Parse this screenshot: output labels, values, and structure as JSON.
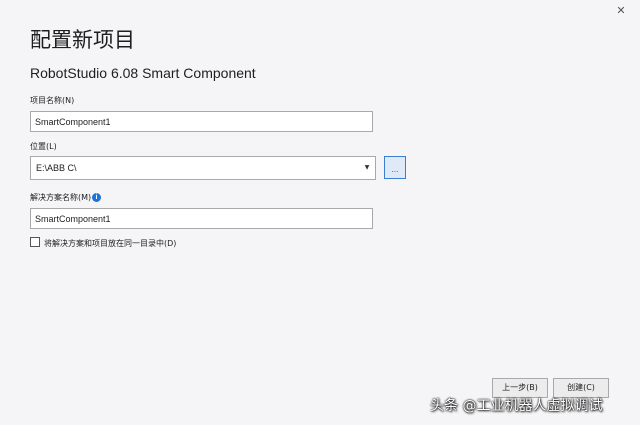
{
  "window": {
    "close_glyph": "✕"
  },
  "page_title": "配置新项目",
  "template_name": "RobotStudio 6.08 Smart Component",
  "project_name": {
    "label": "项目名称(N)",
    "value": "SmartComponent1"
  },
  "location": {
    "label": "位置(L)",
    "value": "E:\\ABB C\\",
    "arrow_glyph": "▼",
    "browse_glyph": "..."
  },
  "solution_name": {
    "label": "解决方案名称(M)",
    "info_glyph": "i",
    "value": "SmartComponent1"
  },
  "same_dir_checkbox": {
    "label": "将解决方案和项目放在同一目录中(D)",
    "checked": false
  },
  "buttons": {
    "previous": "上一步(B)",
    "create": "创建(C)"
  },
  "watermark": "头条 @工业机器人虚拟调试",
  "icons": {
    "close": "close-icon",
    "dropdown": "chevron-down-icon",
    "browse": "ellipsis-icon",
    "info": "info-icon"
  },
  "colors": {
    "background": "#f5f5f7",
    "accent": "#1e73d8",
    "browse_button_border": "#3c7fd0"
  }
}
